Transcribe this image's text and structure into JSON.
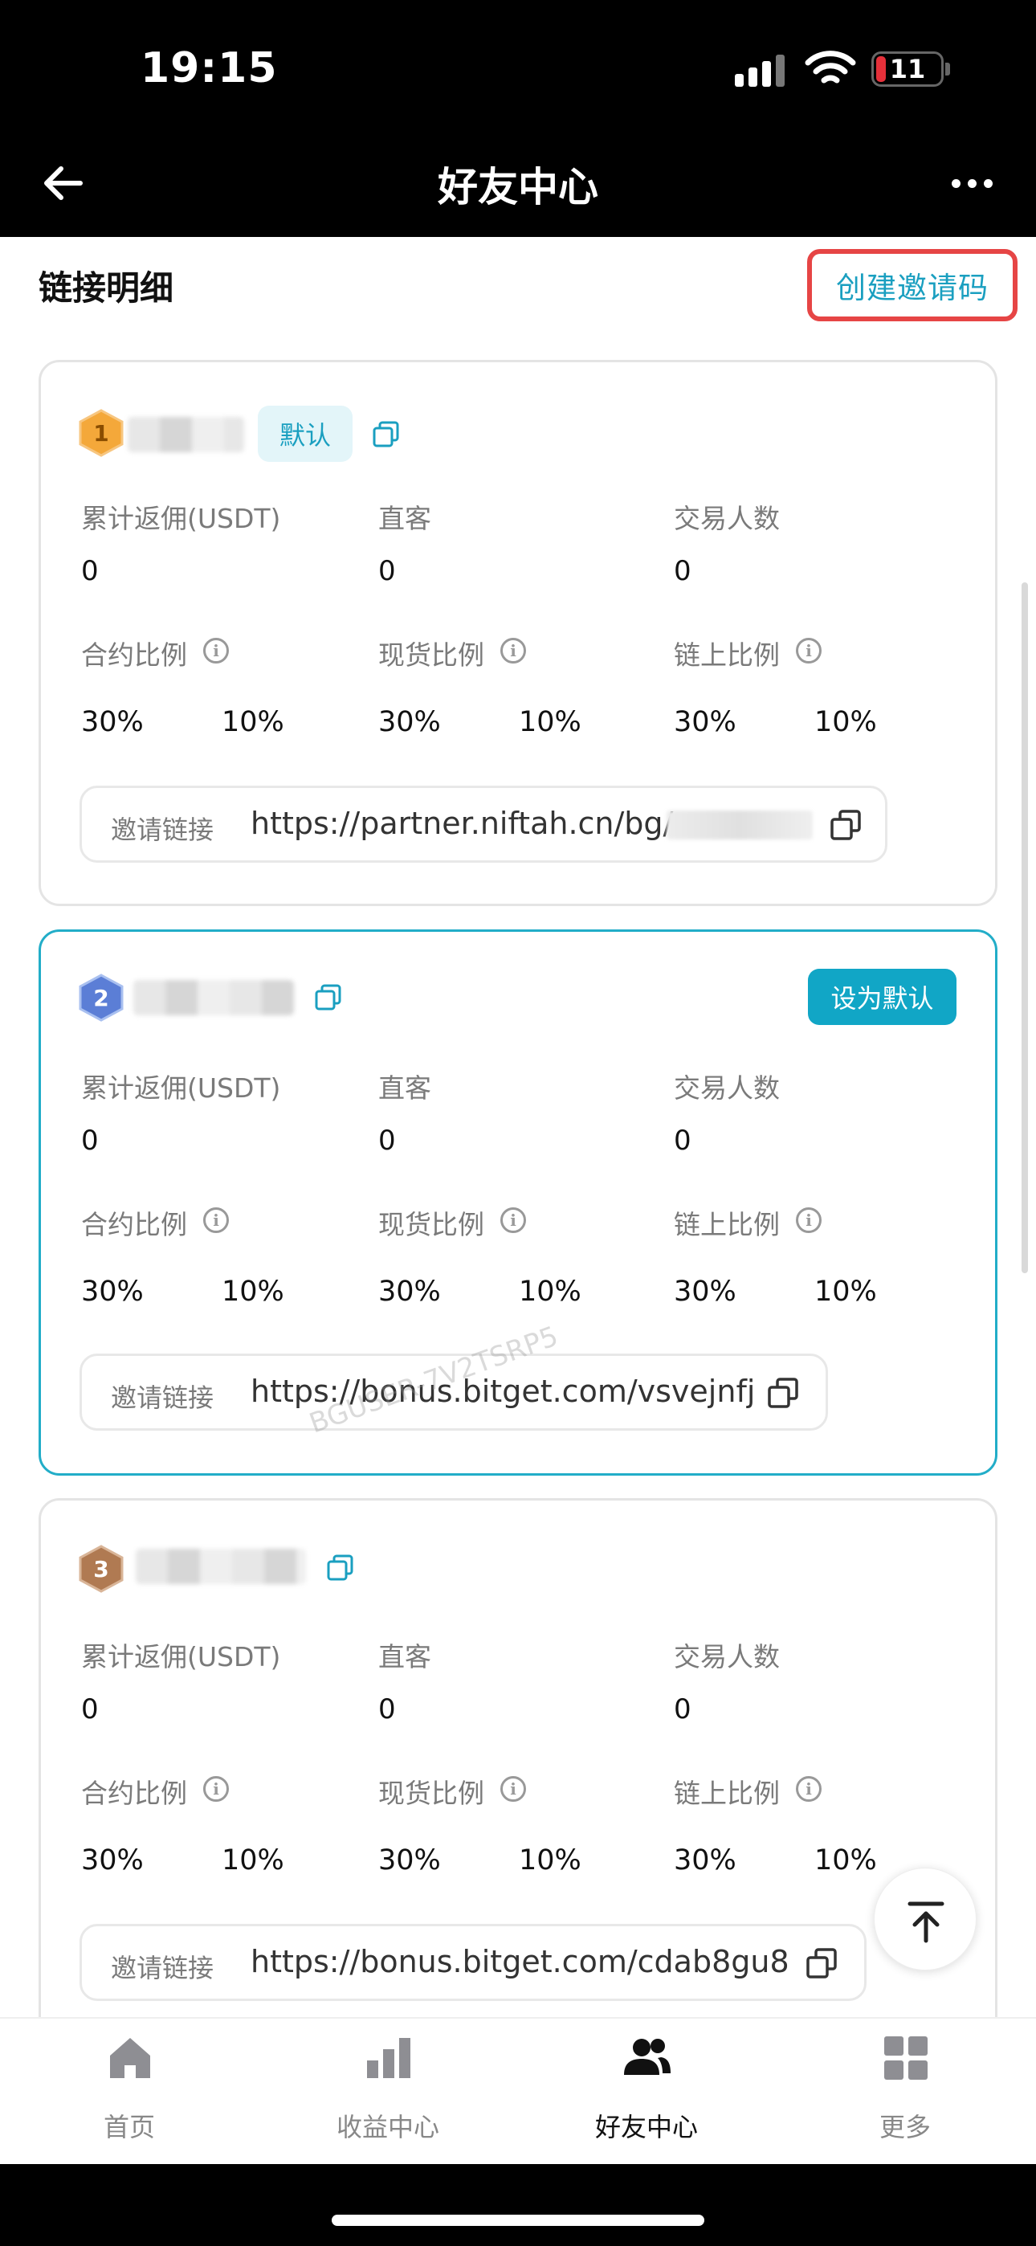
{
  "status_bar": {
    "time": "19:15",
    "battery": "11"
  },
  "header": {
    "title": "好友中心"
  },
  "section": {
    "title": "链接明细",
    "create_button": "创建邀请码"
  },
  "labels": {
    "rebate": "累计返佣(USDT)",
    "direct": "直客",
    "traders": "交易人数",
    "contract_ratio": "合约比例",
    "spot_ratio": "现货比例",
    "onchain_ratio": "链上比例",
    "invite_link": "邀请链接",
    "default_tag": "默认",
    "set_default": "设为默认"
  },
  "cards": [
    {
      "rank": "1",
      "is_default": true,
      "rebate": "0",
      "direct": "0",
      "traders": "0",
      "contract": [
        "30%",
        "10%"
      ],
      "spot": [
        "30%",
        "10%"
      ],
      "onchain": [
        "30%",
        "10%"
      ],
      "link": "https://partner.niftah.cn/bg/"
    },
    {
      "rank": "2",
      "is_default": false,
      "rebate": "0",
      "direct": "0",
      "traders": "0",
      "contract": [
        "30%",
        "10%"
      ],
      "spot": [
        "30%",
        "10%"
      ],
      "onchain": [
        "30%",
        "10%"
      ],
      "link": "https://bonus.bitget.com/vsvejnfj"
    },
    {
      "rank": "3",
      "is_default": false,
      "rebate": "0",
      "direct": "0",
      "traders": "0",
      "contract": [
        "30%",
        "10%"
      ],
      "spot": [
        "30%",
        "10%"
      ],
      "onchain": [
        "30%",
        "10%"
      ],
      "link": "https://bonus.bitget.com/cdab8gu8"
    }
  ],
  "watermark": "BGUSER-7V2TSRP5",
  "tabs": [
    {
      "label": "首页",
      "icon": "home-icon"
    },
    {
      "label": "收益中心",
      "icon": "bar-chart-icon"
    },
    {
      "label": "好友中心",
      "icon": "friends-icon",
      "active": true
    },
    {
      "label": "更多",
      "icon": "grid-icon"
    }
  ],
  "colors": {
    "accent": "#11a6c6",
    "highlight_border": "#e64545",
    "active_card_border": "#22adc8"
  }
}
